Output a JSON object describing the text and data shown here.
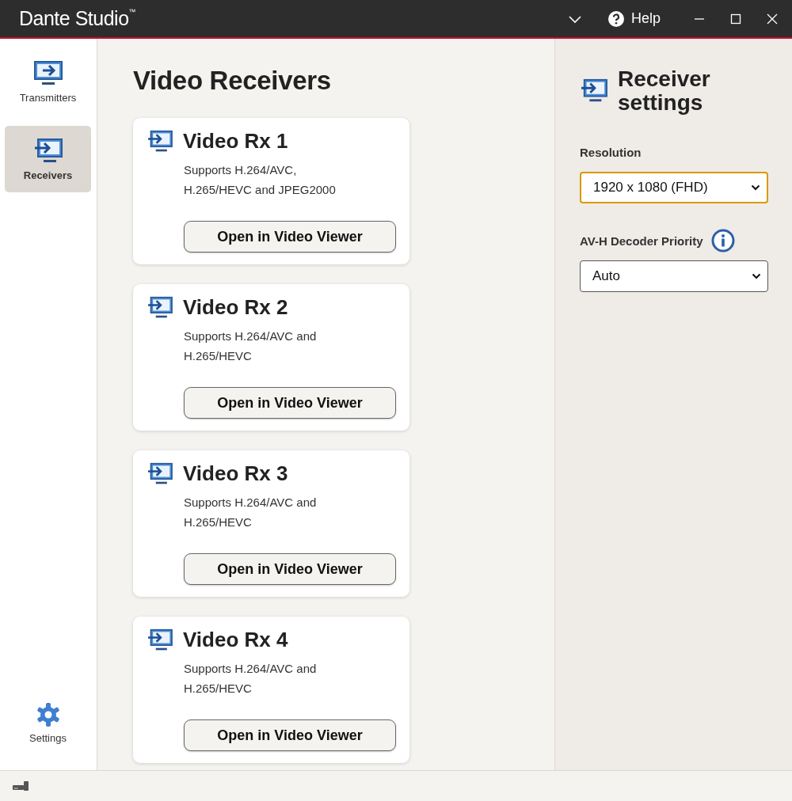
{
  "window": {
    "title": "Dante Studio",
    "title_mark": "™",
    "help": "Help"
  },
  "sidebar": {
    "items": [
      {
        "label": "Transmitters",
        "kind": "transmit",
        "selected": false
      },
      {
        "label": "Receivers",
        "kind": "receive",
        "selected": true
      }
    ],
    "bottom": {
      "label": "Settings"
    }
  },
  "main": {
    "heading": "Video Receivers",
    "cards": [
      {
        "title": "Video Rx 1",
        "description": "Supports H.264/AVC, H.265/HEVC and JPEG2000",
        "button": "Open in Video Viewer"
      },
      {
        "title": "Video Rx 2",
        "description": "Supports H.264/AVC and H.265/HEVC",
        "button": "Open in Video Viewer"
      },
      {
        "title": "Video Rx 3",
        "description": "Supports H.264/AVC and H.265/HEVC",
        "button": "Open in Video Viewer"
      },
      {
        "title": "Video Rx 4",
        "description": "Supports H.264/AVC and H.265/HEVC",
        "button": "Open in Video Viewer"
      }
    ]
  },
  "settings": {
    "heading": "Receiver settings",
    "fields": [
      {
        "label": "Resolution",
        "value": "1920 x 1080 (FHD)",
        "focused": true,
        "info": false
      },
      {
        "label": "AV-H Decoder Priority",
        "value": "Auto",
        "focused": false,
        "info": true
      }
    ]
  }
}
